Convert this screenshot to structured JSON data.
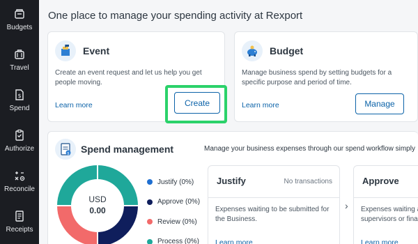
{
  "sidebar": {
    "items": [
      {
        "label": "Budgets",
        "icon": "budgets-icon"
      },
      {
        "label": "Travel",
        "icon": "travel-icon"
      },
      {
        "label": "Spend",
        "icon": "spend-icon"
      },
      {
        "label": "Authorize",
        "icon": "authorize-icon"
      },
      {
        "label": "Reconcile",
        "icon": "reconcile-icon"
      },
      {
        "label": "Receipts",
        "icon": "receipts-icon"
      }
    ]
  },
  "page": {
    "title": "One place to manage your spending activity at Rexport"
  },
  "event": {
    "title": "Event",
    "description_line1": "Create an event request and let us help you get",
    "description_line2": "people moving.",
    "link": "Learn more",
    "button": "Create"
  },
  "budget": {
    "title": "Budget",
    "description_line1": "Manage business spend by setting budgets for a",
    "description_line2": "specific purpose and period of time.",
    "link": "Learn more",
    "button": "Manage"
  },
  "spend": {
    "title": "Spend management",
    "description": "Manage your business expenses through our spend workflow simply",
    "donut": {
      "currency": "USD",
      "amount": "0.00"
    },
    "legend": [
      {
        "label": "Justify (0%)",
        "color": "#1f6fd1"
      },
      {
        "label": "Approve (0%)",
        "color": "#0f1e5c"
      },
      {
        "label": "Review (0%)",
        "color": "#f26a6a"
      },
      {
        "label": "Process (0%)",
        "color": "#1fa89a"
      }
    ],
    "justify": {
      "title": "Justify",
      "meta": "No transactions",
      "desc_line1": "Expenses waiting to be submitted for",
      "desc_line2": "the Business.",
      "link": "Learn more"
    },
    "approve": {
      "title": "Approve",
      "desc_line1": "Expenses waiting a",
      "desc_line2": "supervisors or fina",
      "link": "Learn more"
    }
  }
}
